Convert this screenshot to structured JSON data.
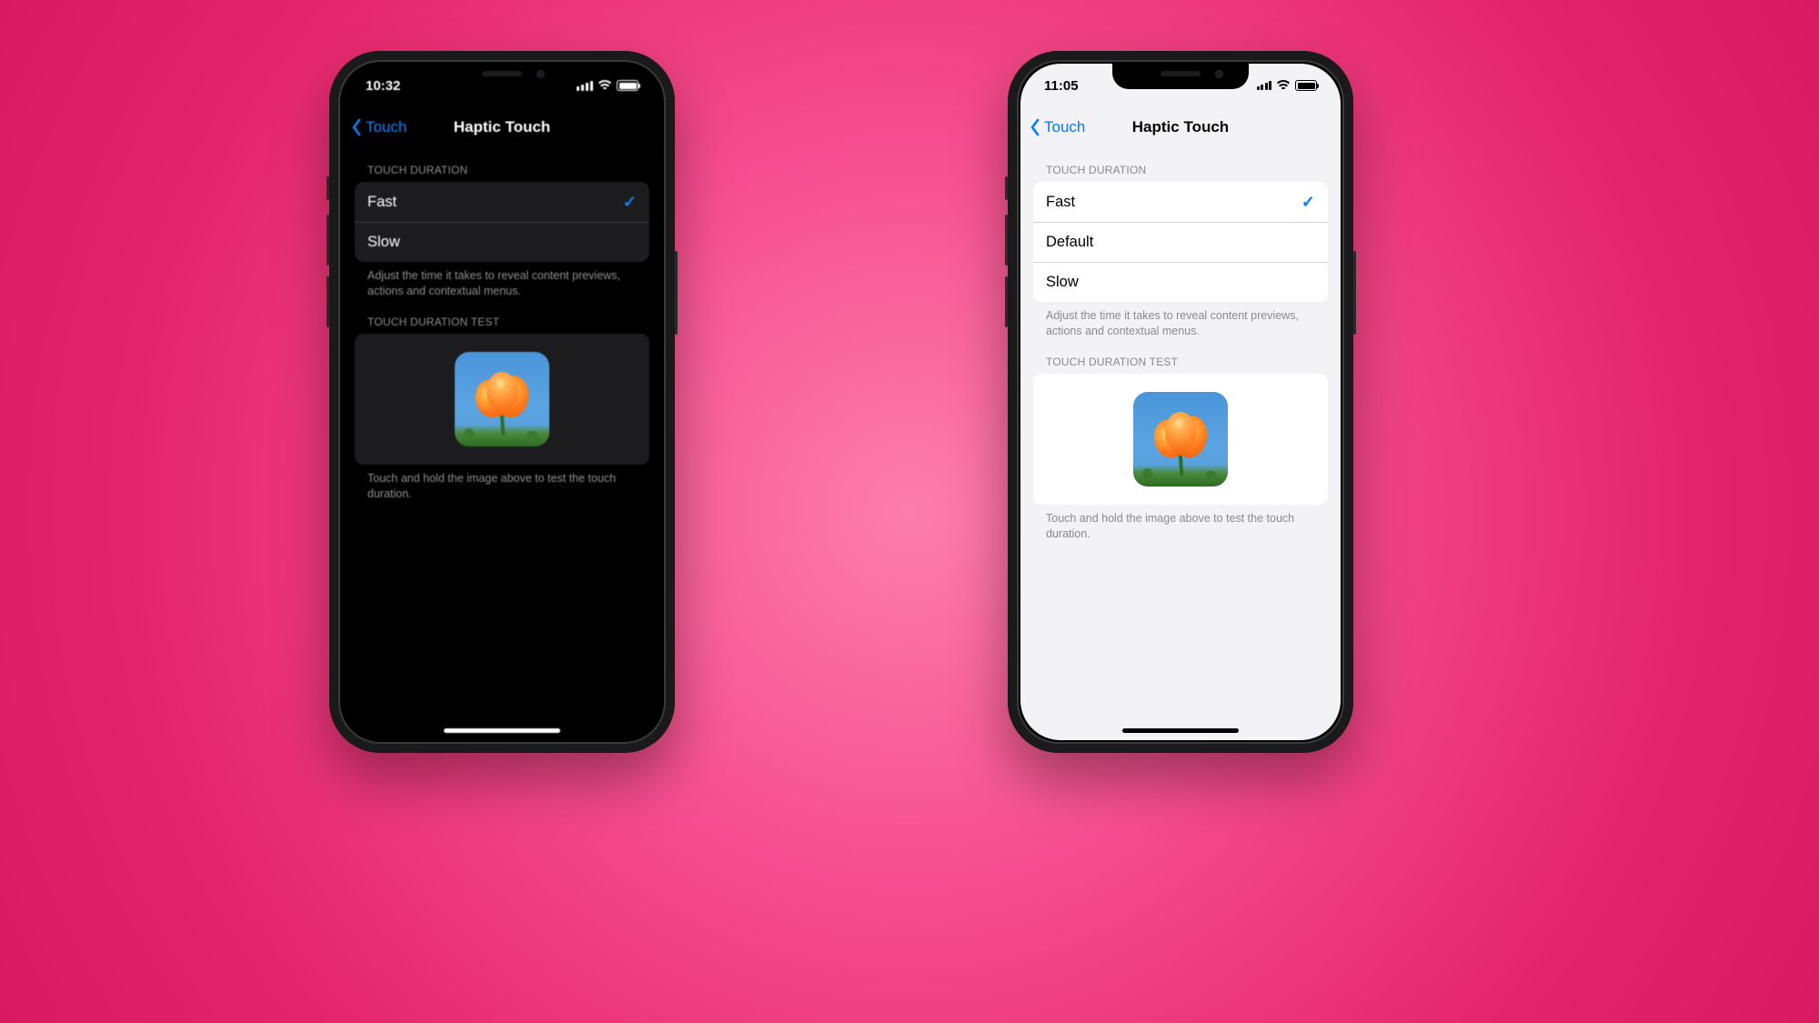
{
  "colors": {
    "ios_blue_dark": "#0a84ff",
    "ios_blue_light": "#007aff"
  },
  "left": {
    "theme": "dark",
    "status": {
      "time": "10:32",
      "signal_style": "dots"
    },
    "nav": {
      "back_label": "Touch",
      "title": "Haptic Touch"
    },
    "sections": {
      "duration_header": "TOUCH DURATION",
      "duration_footer": "Adjust the time it takes to reveal content previews, actions and contextual menus.",
      "options": [
        {
          "label": "Fast",
          "selected": true
        },
        {
          "label": "Slow",
          "selected": false
        }
      ],
      "test_header": "TOUCH DURATION TEST",
      "test_footer": "Touch and hold the image above to test the touch duration."
    }
  },
  "right": {
    "theme": "light",
    "status": {
      "time": "11:05",
      "signal_style": "bars"
    },
    "nav": {
      "back_label": "Touch",
      "title": "Haptic Touch"
    },
    "sections": {
      "duration_header": "TOUCH DURATION",
      "duration_footer": "Adjust the time it takes to reveal content previews, actions and contextual menus.",
      "options": [
        {
          "label": "Fast",
          "selected": true
        },
        {
          "label": "Default",
          "selected": false
        },
        {
          "label": "Slow",
          "selected": false
        }
      ],
      "test_header": "TOUCH DURATION TEST",
      "test_footer": "Touch and hold the image above to test the touch duration."
    }
  }
}
